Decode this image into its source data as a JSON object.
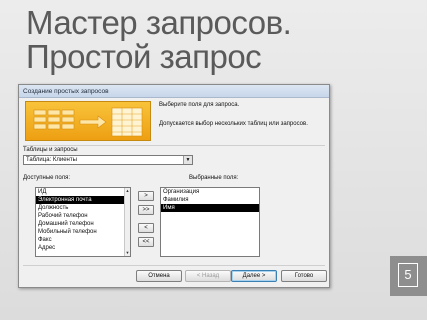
{
  "slide": {
    "title_line1": "Мастер запросов.",
    "title_line2": "Простой запрос",
    "page_number": "5"
  },
  "wizard": {
    "window_title": "Создание простых запросов",
    "instruction1": "Выберите поля для запроса.",
    "instruction2": "Допускается выбор нескольких таблиц или запросов.",
    "tables_label": "Таблицы и запросы",
    "tables_value": "Таблица: Клиенты",
    "available_label": "Доступные поля:",
    "selected_label": "Выбранные поля:",
    "available_fields": [
      {
        "label": "ИД",
        "selected": false
      },
      {
        "label": "Электронная почта",
        "selected": true
      },
      {
        "label": "Должность",
        "selected": false
      },
      {
        "label": "Рабочий телефон",
        "selected": false
      },
      {
        "label": "Домашний телефон",
        "selected": false
      },
      {
        "label": "Мобильный телефон",
        "selected": false
      },
      {
        "label": "Факс",
        "selected": false
      },
      {
        "label": "Адрес",
        "selected": false
      }
    ],
    "selected_fields": [
      {
        "label": "Организация",
        "selected": false
      },
      {
        "label": "Фамилия",
        "selected": false
      },
      {
        "label": "Имя",
        "selected": true
      }
    ],
    "move_buttons": {
      "add_one": ">",
      "add_all": ">>",
      "remove_one": "<",
      "remove_all": "<<"
    },
    "buttons": {
      "cancel": "Отмена",
      "back": "< Назад",
      "next": "Далее >",
      "finish": "Готово"
    }
  },
  "colors": {
    "banner": "#f2a91f",
    "selection": "#000000",
    "title_text": "#5a5a5a"
  }
}
